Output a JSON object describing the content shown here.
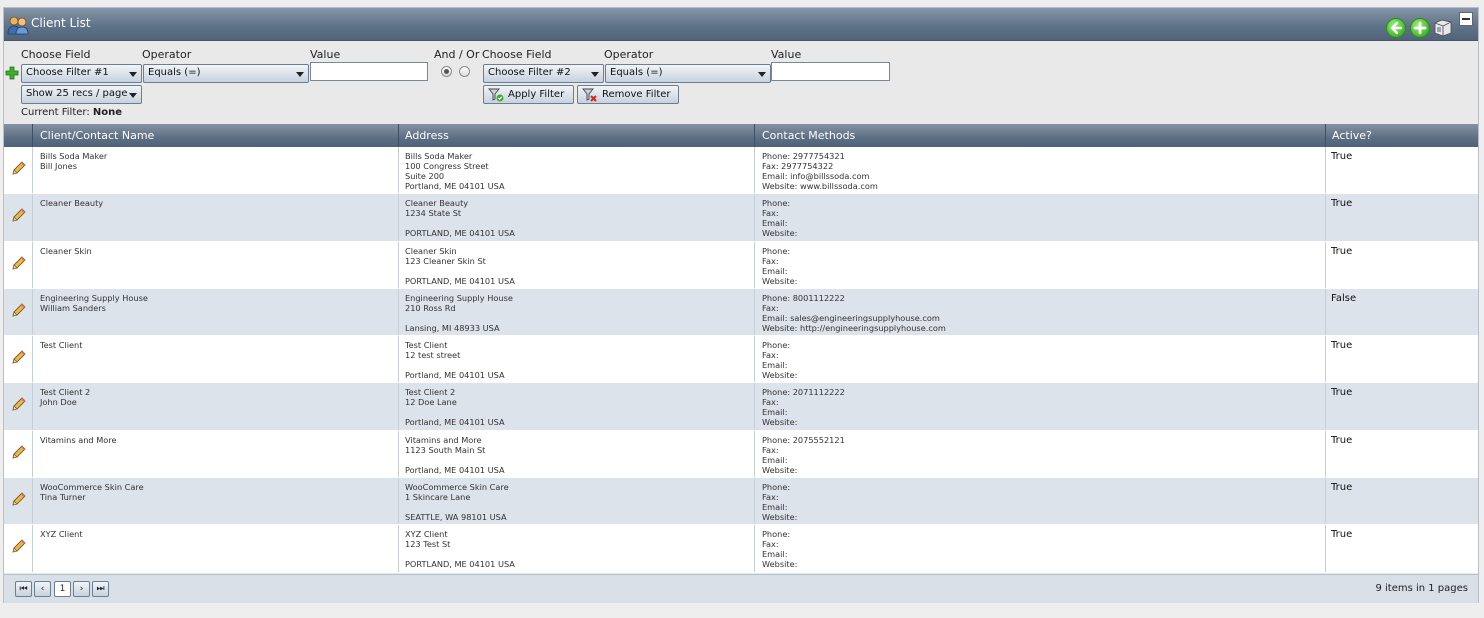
{
  "window": {
    "title": "Client List"
  },
  "filter": {
    "f1": {
      "field_label": "Choose Field",
      "operator_label": "Operator",
      "value_label": "Value",
      "field_value": "Choose Filter #1",
      "operator_value": "Equals (=)",
      "value": ""
    },
    "andor_label": "And / Or",
    "f2": {
      "field_label": "Choose Field",
      "operator_label": "Operator",
      "value_label": "Value",
      "field_value": "Choose Filter #2",
      "operator_value": "Equals (=)",
      "value": ""
    },
    "page_size": "Show 25 recs / page",
    "apply_label": "Apply Filter",
    "remove_label": "Remove Filter",
    "current_label": "Current Filter:",
    "current_value": "None"
  },
  "grid": {
    "headers": {
      "name": "Client/Contact Name",
      "address": "Address",
      "contact": "Contact Methods",
      "active": "Active?"
    },
    "rows": [
      {
        "name": [
          "Bills Soda Maker",
          "Bill Jones"
        ],
        "address": [
          "Bills Soda Maker",
          "100 Congress Street",
          "Suite 200",
          "Portland, ME 04101 USA"
        ],
        "contact": [
          "Phone: 2977754321",
          "Fax: 2977754322",
          "Email: info@billssoda.com",
          "Website: www.billssoda.com"
        ],
        "active": "True"
      },
      {
        "name": [
          "Cleaner Beauty"
        ],
        "address": [
          "Cleaner Beauty",
          "1234 State St",
          "",
          "PORTLAND, ME 04101 USA"
        ],
        "contact": [
          "Phone:",
          "Fax:",
          "Email:",
          "Website:"
        ],
        "active": "True"
      },
      {
        "name": [
          "Cleaner Skin"
        ],
        "address": [
          "Cleaner Skin",
          "123 Cleaner Skin St",
          "",
          "PORTLAND, ME 04101 USA"
        ],
        "contact": [
          "Phone:",
          "Fax:",
          "Email:",
          "Website:"
        ],
        "active": "True"
      },
      {
        "name": [
          "Engineering Supply House",
          "William Sanders"
        ],
        "address": [
          "Engineering Supply House",
          "210 Ross Rd",
          "",
          "Lansing, MI 48933 USA"
        ],
        "contact": [
          "Phone: 8001112222",
          "Fax:",
          "Email: sales@engineeringsupplyhouse.com",
          "Website: http://engineeringsupplyhouse.com"
        ],
        "active": "False"
      },
      {
        "name": [
          "Test Client"
        ],
        "address": [
          "Test Client",
          "12 test street",
          "",
          "Portland, ME 04101 USA"
        ],
        "contact": [
          "Phone:",
          "Fax:",
          "Email:",
          "Website:"
        ],
        "active": "True"
      },
      {
        "name": [
          "Test Client 2",
          "John Doe"
        ],
        "address": [
          "Test Client 2",
          "12 Doe Lane",
          "",
          "Portland, ME 04101 USA"
        ],
        "contact": [
          "Phone: 2071112222",
          "Fax:",
          "Email:",
          "Website:"
        ],
        "active": "True"
      },
      {
        "name": [
          "Vitamins and More"
        ],
        "address": [
          "Vitamins and More",
          "1123 South Main St",
          "",
          "Portland, ME 04101 USA"
        ],
        "contact": [
          "Phone: 2075552121",
          "Fax:",
          "Email:",
          "Website:"
        ],
        "active": "True"
      },
      {
        "name": [
          "WooCommerce Skin Care",
          "Tina Turner"
        ],
        "address": [
          "WooCommerce Skin Care",
          "1 Skincare Lane",
          "",
          "SEATTLE, WA 98101 USA"
        ],
        "contact": [
          "Phone:",
          "Fax:",
          "Email:",
          "Website:"
        ],
        "active": "True"
      },
      {
        "name": [
          "XYZ Client"
        ],
        "address": [
          "XYZ Client",
          "123 Test St",
          "",
          "PORTLAND, ME 04101 USA"
        ],
        "contact": [
          "Phone:",
          "Fax:",
          "Email:",
          "Website:"
        ],
        "active": "True"
      }
    ]
  },
  "pager": {
    "current_page": "1",
    "info": "9 items in 1 pages"
  },
  "colors": {
    "header": "#5f7389",
    "alt_row": "#dde3ea",
    "accent_green": "#42b52b"
  },
  "icons": [
    "users-icon",
    "back-icon",
    "add-icon",
    "box-icon",
    "minimize-icon",
    "add-filter-icon",
    "apply-filter-icon",
    "remove-filter-icon",
    "edit-pencil-icon"
  ]
}
